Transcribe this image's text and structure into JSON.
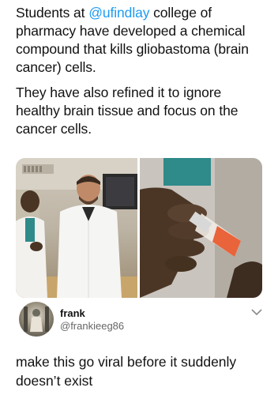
{
  "post": {
    "para1_prefix": "Students at ",
    "mention": "@ufindlay",
    "para1_suffix": " college of pharmacy have developed a chemical compound that kills gliobastoma (brain cancer) cells.",
    "para2": "They have also refined it to ignore healthy brain tissue and focus on the cancer cells."
  },
  "media": {
    "left_alt": "photo-of-students-in-lab-coats",
    "right_alt": "photo-of-hand-holding-vial"
  },
  "reply": {
    "name": "frank",
    "handle": "@frankieeg86",
    "text": "make this go viral before it suddenly doesn’t exist",
    "chevron_icon": "chevron-down-icon"
  },
  "colors": {
    "mention": "#1d9bf0",
    "text": "#111111",
    "secondary": "#666666"
  }
}
